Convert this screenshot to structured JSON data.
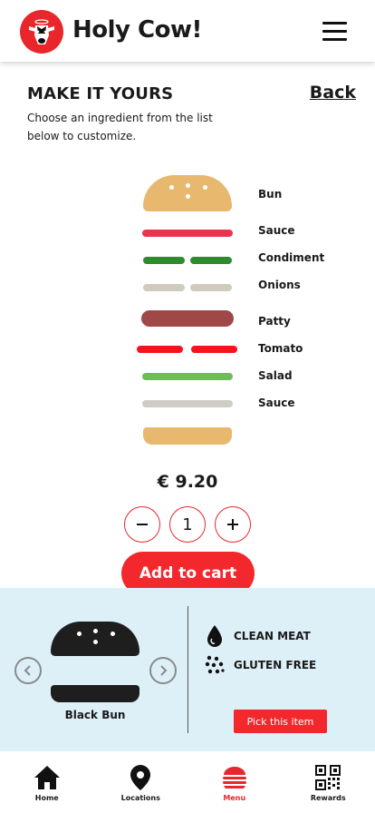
{
  "header": {
    "brand": "Holy Cow!"
  },
  "page": {
    "title": "MAKE IT YOURS",
    "subtitle": "Choose an ingredient from the list below to customize.",
    "back_label": "Back"
  },
  "ingredients": [
    {
      "label": "Bun",
      "color": "#e8b86e"
    },
    {
      "label": "Sauce",
      "color": "#e8344f"
    },
    {
      "label": "Condiment",
      "color": "#2e8b2e"
    },
    {
      "label": "Onions",
      "color": "#cfcbbd"
    },
    {
      "label": "Patty",
      "color": "#a04848"
    },
    {
      "label": "Tomato",
      "color": "#f5141b"
    },
    {
      "label": "Salad",
      "color": "#6dbb5a"
    },
    {
      "label": "Sauce",
      "color": "#cfcbc5"
    }
  ],
  "order": {
    "price": "€ 9.20",
    "quantity": "1",
    "add_to_cart_label": "Add to cart"
  },
  "detail": {
    "item_name": "Black Bun",
    "features": [
      "CLEAN MEAT",
      "GLUTEN FREE"
    ],
    "pick_label": "Pick this item"
  },
  "nav": {
    "items": [
      {
        "label": "Home",
        "icon": "home-icon"
      },
      {
        "label": "Locations",
        "icon": "location-pin-icon"
      },
      {
        "label": "Menu",
        "icon": "burger-icon",
        "active": true
      },
      {
        "label": "Rewards",
        "icon": "qr-code-icon"
      }
    ]
  },
  "colors": {
    "accent": "#f2282d",
    "panel_bg": "#ddf0f7",
    "bun": "#e8b86e"
  }
}
